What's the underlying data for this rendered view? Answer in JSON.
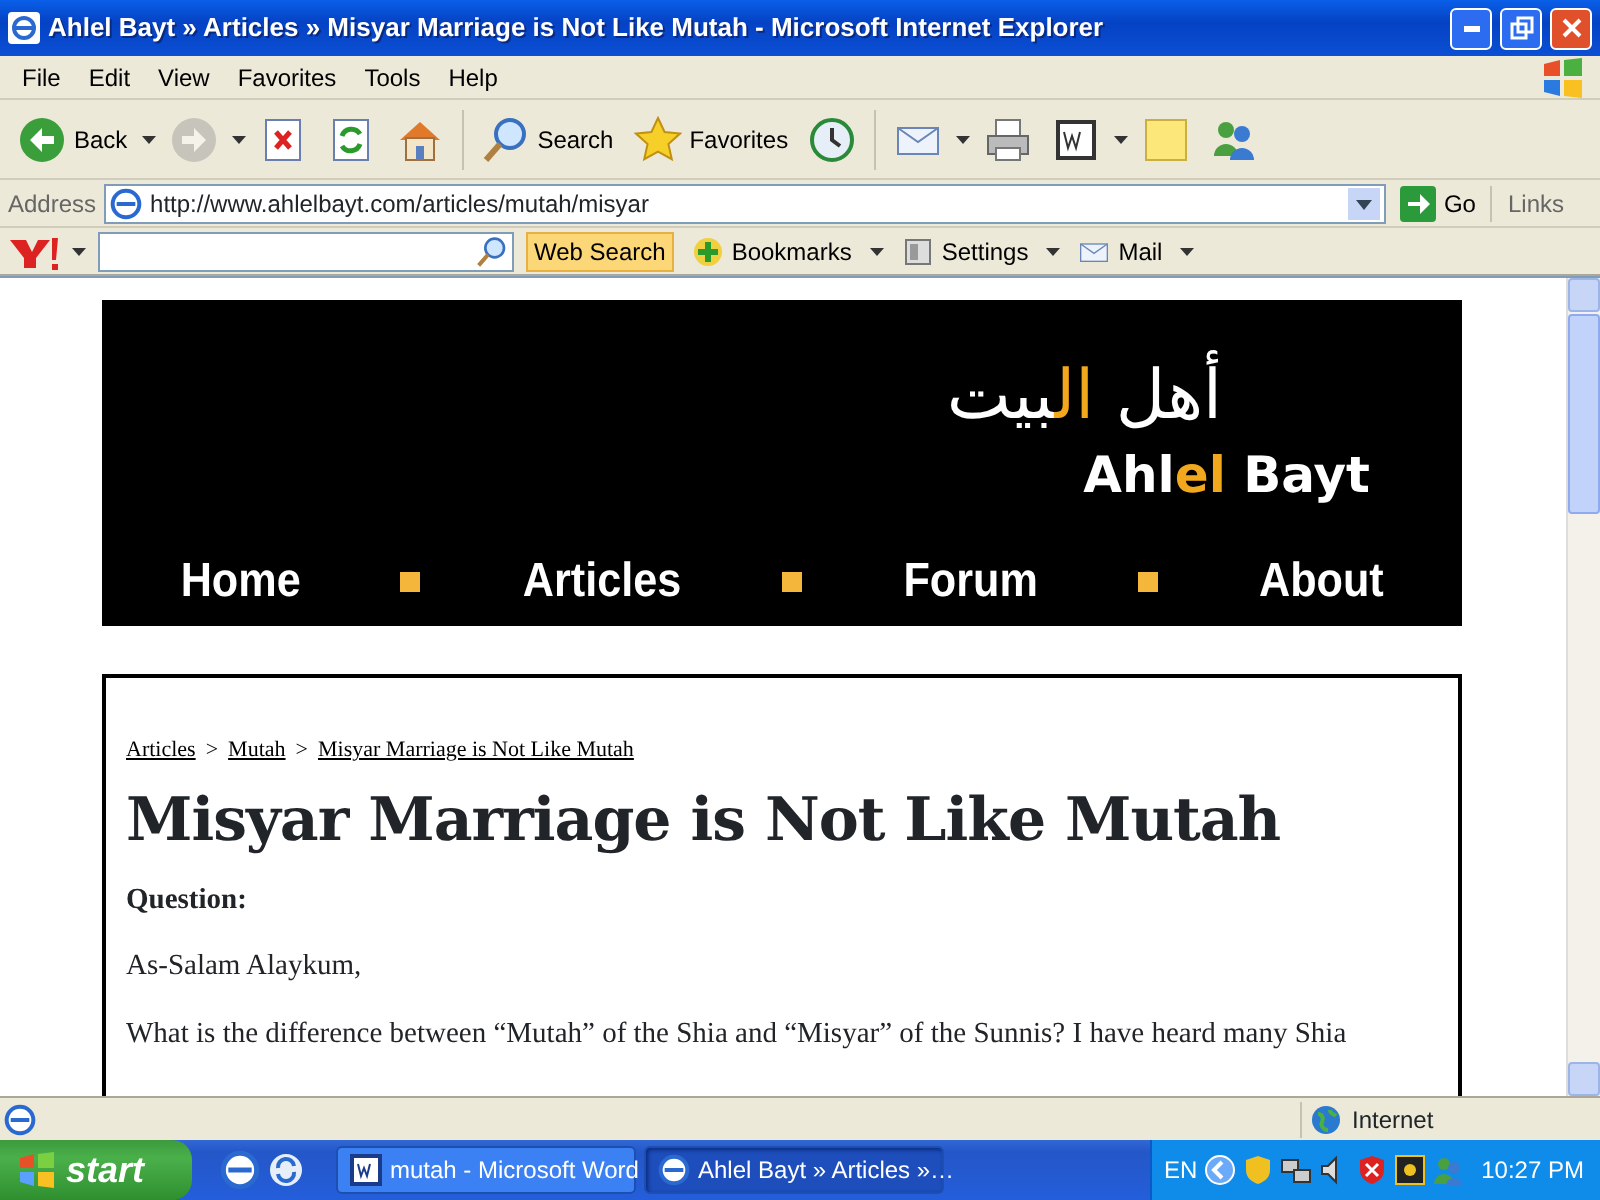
{
  "window": {
    "title": "Ahlel Bayt » Articles » Misyar Marriage is Not Like Mutah - Microsoft Internet Explorer"
  },
  "menu": [
    "File",
    "Edit",
    "View",
    "Favorites",
    "Tools",
    "Help"
  ],
  "toolbar": [
    {
      "kind": "back",
      "label": "Back",
      "disabled": false
    },
    {
      "kind": "forward",
      "disabled": true
    },
    {
      "kind": "stop",
      "disabled": false
    },
    {
      "kind": "refresh",
      "disabled": false
    },
    {
      "kind": "home",
      "disabled": false
    },
    {
      "kind": "search",
      "label": "Search",
      "disabled": false
    },
    {
      "kind": "favorites",
      "label": "Favorites",
      "disabled": false
    },
    {
      "kind": "history",
      "disabled": false
    },
    {
      "kind": "mail",
      "disabled": false
    },
    {
      "kind": "print",
      "disabled": false
    },
    {
      "kind": "word",
      "disabled": false
    },
    {
      "kind": "note",
      "disabled": false
    },
    {
      "kind": "messenger",
      "disabled": false
    }
  ],
  "address": {
    "label": "Address",
    "url": "http://www.ahlelbayt.com/articles/mutah/misyar",
    "go": "Go",
    "links": "Links"
  },
  "yahoo_bar": {
    "search_button": "Web Search",
    "items": [
      {
        "kind": "bookmarks",
        "label": "Bookmarks"
      },
      {
        "kind": "settings",
        "label": "Settings"
      },
      {
        "kind": "mail",
        "label": "Mail"
      }
    ]
  },
  "page": {
    "logo": {
      "arabic": [
        {
          "text": "أهل ",
          "accent": false
        },
        {
          "text": "ال",
          "accent": true
        },
        {
          "text": "بيت",
          "accent": false
        }
      ],
      "latin": [
        {
          "text": "Ahl",
          "accent": false
        },
        {
          "text": "el",
          "accent": true
        },
        {
          "text": " Bayt",
          "accent": false
        }
      ]
    },
    "nav": [
      "Home",
      "Articles",
      "Forum",
      "About"
    ],
    "breadcrumb": [
      {
        "kind": "link",
        "text": "Articles"
      },
      {
        "kind": "separator",
        "text": ">"
      },
      {
        "kind": "link",
        "text": "Mutah"
      },
      {
        "kind": "separator",
        "text": ">"
      },
      {
        "kind": "link",
        "text": "Misyar Marriage is Not Like Mutah"
      }
    ],
    "heading": "Misyar Marriage is Not Like Mutah",
    "question_label": "Question:",
    "paragraphs": [
      "As-Salam Alaykum,",
      "What is the difference between “Mutah” of the Shia and “Misyar” of the Sunnis? I have heard many Shia"
    ]
  },
  "status_bar": {
    "zone": "Internet"
  },
  "taskbar": {
    "start": "start",
    "tasks": [
      {
        "label": "mutah - Microsoft Word",
        "kind": "word",
        "selected": false
      },
      {
        "label": "Ahlel Bayt » Articles »…",
        "kind": "ie",
        "selected": true
      }
    ],
    "language": "EN",
    "clock": "10:27 PM"
  }
}
